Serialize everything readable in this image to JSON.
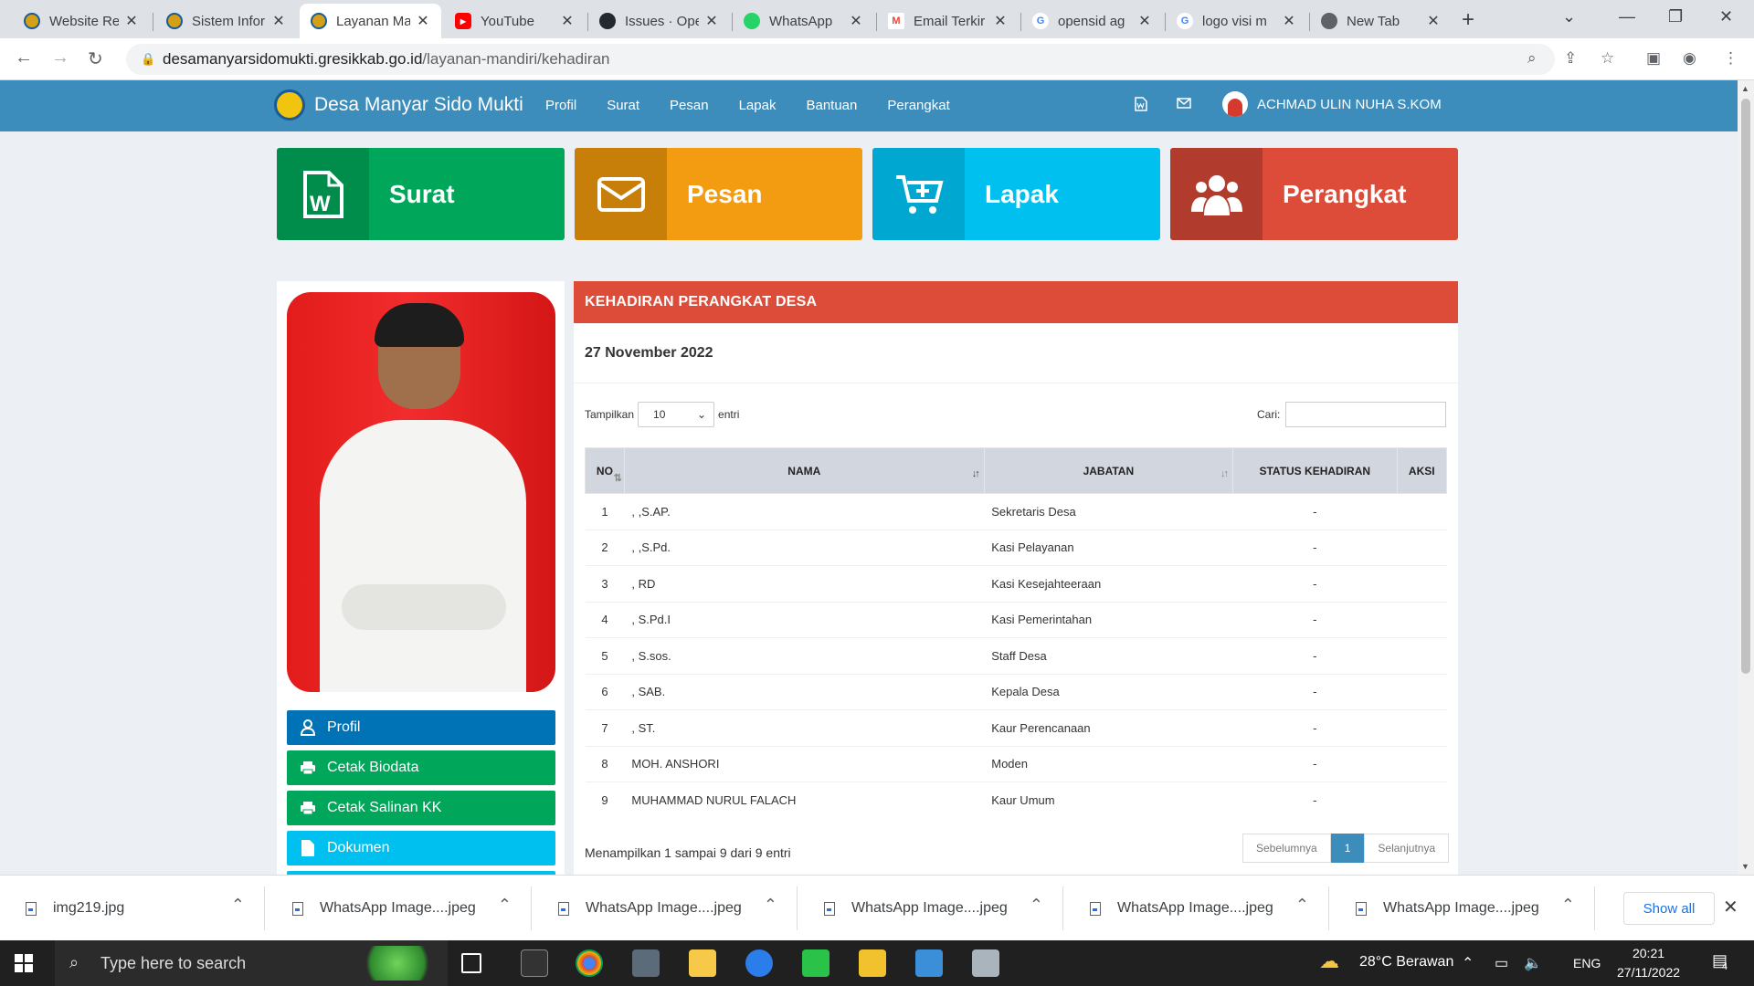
{
  "browser": {
    "tabs": [
      {
        "title": "Website Re",
        "icon": "garuda-icon",
        "active": false
      },
      {
        "title": "Sistem Infor",
        "icon": "garuda-icon",
        "active": false
      },
      {
        "title": "Layanan Ma",
        "icon": "garuda-icon",
        "active": true
      },
      {
        "title": "YouTube",
        "icon": "youtube-icon",
        "active": false
      },
      {
        "title": "Issues · Ope",
        "icon": "github-icon",
        "active": false
      },
      {
        "title": "WhatsApp",
        "icon": "whatsapp-icon",
        "active": false
      },
      {
        "title": "Email Terkir",
        "icon": "gmail-icon",
        "active": false
      },
      {
        "title": "opensid ag",
        "icon": "google-icon",
        "active": false
      },
      {
        "title": "logo visi m",
        "icon": "google-icon",
        "active": false
      },
      {
        "title": "New Tab",
        "icon": "chrome-icon",
        "active": false
      }
    ],
    "url_host": "desamanyarsidomukti.gresikkab.go.id",
    "url_path": "/layanan-mandiri/kehadiran"
  },
  "site": {
    "brand": "Desa Manyar Sido Mukti",
    "menu": [
      "Profil",
      "Surat",
      "Pesan",
      "Lapak",
      "Bantuan",
      "Perangkat"
    ],
    "user": "ACHMAD ULIN NUHA S.KOM",
    "tiles": [
      {
        "label": "Surat",
        "icon": "word-document-icon",
        "dark": "#008d4c",
        "light": "#00a65a"
      },
      {
        "label": "Pesan",
        "icon": "envelope-icon",
        "dark": "#c87f0a",
        "light": "#f39c12"
      },
      {
        "label": "Lapak",
        "icon": "cart-plus-icon",
        "dark": "#00a7d0",
        "light": "#00c0ef"
      },
      {
        "label": "Perangkat",
        "icon": "users-icon",
        "dark": "#b13c2e",
        "light": "#dd4b39"
      }
    ],
    "side_buttons": [
      {
        "label": "Profil",
        "icon": "user-icon",
        "color": "#0073b7"
      },
      {
        "label": "Cetak Biodata",
        "icon": "printer-icon",
        "color": "#00a65a"
      },
      {
        "label": "Cetak Salinan KK",
        "icon": "printer-icon",
        "color": "#00a65a"
      },
      {
        "label": "Dokumen",
        "icon": "file-icon",
        "color": "#00c0ef"
      }
    ]
  },
  "attendance": {
    "heading": "KEHADIRAN PERANGKAT DESA",
    "date": "27 November 2022",
    "show_label": "Tampilkan",
    "show_value": "10",
    "entries_label": "entri",
    "search_label": "Cari:",
    "columns": [
      "NO",
      "NAMA",
      "JABATAN",
      "STATUS KEHADIRAN",
      "AKSI"
    ],
    "rows": [
      {
        "no": "1",
        "nama": ", ,S.AP.",
        "jabatan": "Sekretaris Desa",
        "status": "-"
      },
      {
        "no": "2",
        "nama": ", ,S.Pd.",
        "jabatan": "Kasi Pelayanan",
        "status": "-"
      },
      {
        "no": "3",
        "nama": ", RD",
        "jabatan": "Kasi Kesejahteeraan",
        "status": "-"
      },
      {
        "no": "4",
        "nama": ", S.Pd.I",
        "jabatan": "Kasi Pemerintahan",
        "status": "-"
      },
      {
        "no": "5",
        "nama": ", S.sos.",
        "jabatan": "Staff Desa",
        "status": "-"
      },
      {
        "no": "6",
        "nama": ", SAB.",
        "jabatan": "Kepala Desa",
        "status": "-"
      },
      {
        "no": "7",
        "nama": ", ST.",
        "jabatan": "Kaur Perencanaan",
        "status": "-"
      },
      {
        "no": "8",
        "nama": "MOH. ANSHORI",
        "jabatan": "Moden",
        "status": "-"
      },
      {
        "no": "9",
        "nama": "MUHAMMAD NURUL FALACH",
        "jabatan": "Kaur Umum",
        "status": "-"
      }
    ],
    "info": "Menampilkan 1 sampai 9 dari 9 entri",
    "prev_label": "Sebelumnya",
    "current_page": "1",
    "next_label": "Selanjutnya"
  },
  "downloads": {
    "files": [
      "img219.jpg",
      "WhatsApp Image....jpeg",
      "WhatsApp Image....jpeg",
      "WhatsApp Image....jpeg",
      "WhatsApp Image....jpeg",
      "WhatsApp Image....jpeg"
    ],
    "show_all": "Show all"
  },
  "taskbar": {
    "search_placeholder": "Type here to search",
    "weather": "28°C  Berawan",
    "lang": "ENG",
    "time": "20:21",
    "date": "27/11/2022",
    "notifications": "4"
  }
}
